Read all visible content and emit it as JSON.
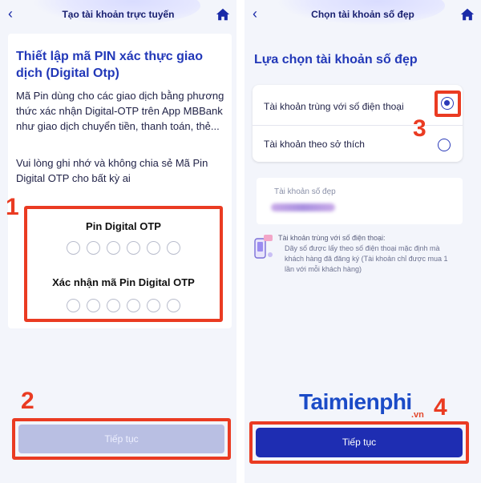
{
  "left_screen": {
    "header_title": "Tạo tài khoản trực tuyến",
    "title": "Thiết lập mã PIN xác thực giao dịch (Digital Otp)",
    "paragraph1": "Mã Pin dùng cho các giao dịch bằng phương thức xác nhận Digital-OTP trên App MBBank như giao dịch chuyển tiền, thanh toán, thẻ...",
    "paragraph2": "Vui lòng ghi nhớ và không chia sẻ Mã Pin Digital OTP cho bất kỳ ai",
    "pin_label": "Pin Digital OTP",
    "confirm_pin_label": "Xác nhận mã Pin Digital OTP",
    "continue_button": "Tiếp tục"
  },
  "right_screen": {
    "header_title": "Chọn tài khoản số đẹp",
    "heading": "Lựa chọn tài khoản số đẹp",
    "option1": "Tài khoản trùng với số điện thoại",
    "option2": "Tài khoản theo sở thích",
    "selected_option": "option1",
    "field_label": "Tài khoản số đẹp",
    "info_head": "Tài khoản trùng với số điện thoại:",
    "info_body": "Dãy số được lấy theo số điện thoại mặc định mà khách hàng đã đăng ký (Tài khoản chỉ được mua 1 lần với mỗi khách hàng)",
    "continue_button": "Tiếp tục"
  },
  "annotations": {
    "n1": "1",
    "n2": "2",
    "n3": "3",
    "n4": "4"
  },
  "watermark": {
    "main": "Taimienphi",
    "suffix": ".vn"
  },
  "colors": {
    "accent": "#2238b8",
    "primary_button": "#1e2db2",
    "disabled_button": "#b9bfe3",
    "highlight": "#ea3b22"
  },
  "icons": {
    "back": "chevron-left-icon",
    "home": "home-icon",
    "info": "phone-info-icon"
  }
}
